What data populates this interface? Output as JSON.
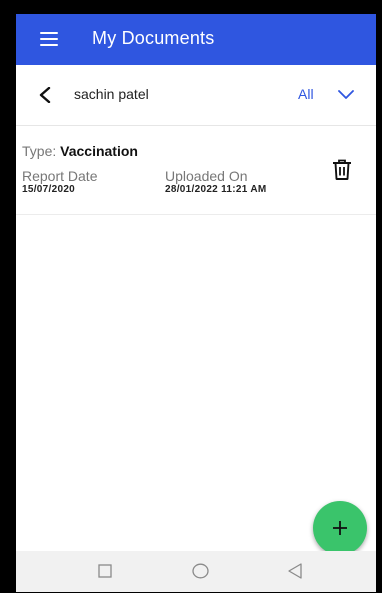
{
  "app_bar": {
    "title": "My Documents",
    "menu_icon": "hamburger-menu-icon",
    "color": "#2f56e0"
  },
  "filter_bar": {
    "back_icon": "back-arrow-icon",
    "patient_name": "sachin patel",
    "filter_value": "All",
    "dropdown_icon": "chevron-down-icon"
  },
  "documents": [
    {
      "type_label": "Type:",
      "type_value": "Vaccination",
      "report_date_label": "Report Date",
      "report_date_value": "15/07/2020",
      "uploaded_label": "Uploaded On",
      "uploaded_value": "28/01/2022 11:21 AM",
      "delete_icon": "trash-icon"
    }
  ],
  "fab": {
    "icon": "plus-icon",
    "color": "#3ac46b"
  },
  "system_nav": {
    "recent_icon": "square-icon",
    "home_icon": "circle-icon",
    "back_icon": "triangle-back-icon"
  }
}
